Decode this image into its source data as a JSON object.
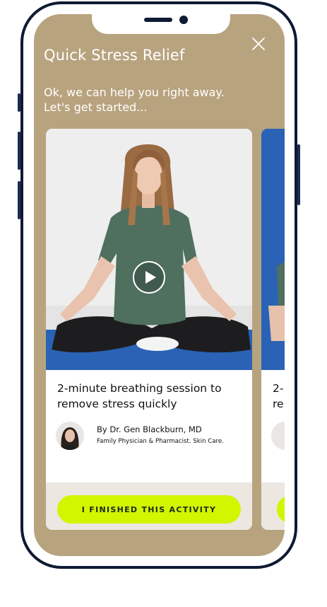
{
  "header": {
    "title": "Quick Stress Relief",
    "subtitle_line1": "Ok, we can help you right away.",
    "subtitle_line2": "Let's get started..."
  },
  "icons": {
    "close": "close-icon",
    "play": "play-icon"
  },
  "card": {
    "title_line1": "2-minute breathing session to",
    "title_line2": "remove stress quickly",
    "author": "By Dr. Gen Blackburn, MD",
    "role": "Family Physician & Pharmacist. Skin Care.",
    "cta_label": "I FINISHED THIS ACTIVITY"
  },
  "next_card": {
    "title_line1": "2-",
    "title_line2": "re"
  },
  "colors": {
    "background": "#b8a37f",
    "accent": "#d2f500",
    "mat": "#2a63b5",
    "frame": "#0f1a33"
  }
}
